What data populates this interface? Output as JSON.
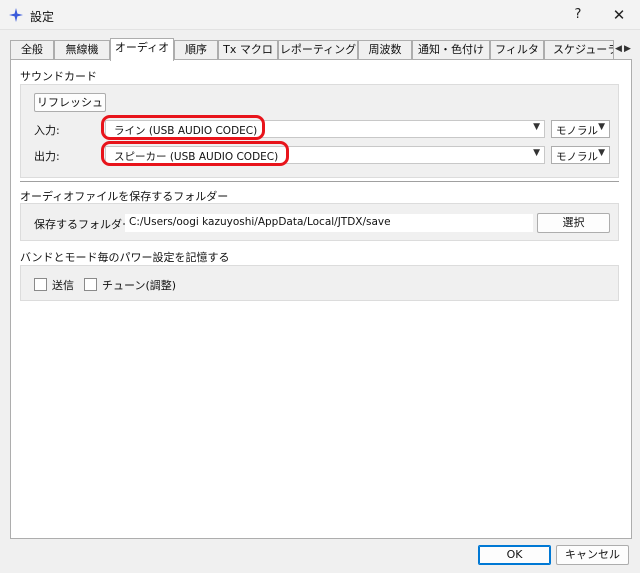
{
  "window": {
    "title": "設定",
    "help_label": "?",
    "close_label": "✕"
  },
  "tabs": [
    {
      "label": "全般"
    },
    {
      "label": "無線機"
    },
    {
      "label": "オーディオ",
      "active": true
    },
    {
      "label": "順序"
    },
    {
      "label": "Tx マクロ"
    },
    {
      "label": "レポーティング"
    },
    {
      "label": "周波数"
    },
    {
      "label": "通知・色付け"
    },
    {
      "label": "フィルタ"
    },
    {
      "label": "スケジューラ"
    }
  ],
  "tab_scroll": {
    "left": "◀",
    "right": "▶"
  },
  "soundcard": {
    "section_label": "サウンドカード",
    "refresh_button": "リフレッシュ",
    "input_label": "入力:",
    "input_device": "ライン (USB AUDIO  CODEC)",
    "input_channel": "モノラル",
    "output_label": "出力:",
    "output_device": "スピーカー (USB AUDIO  CODEC)",
    "output_channel": "モノラル",
    "highlight_color": "#e8141b"
  },
  "save_folder": {
    "section_label": "オーディオファイルを保存するフォルダー",
    "label": "保存するフォルダー:",
    "path": "C:/Users/oogi kazuyoshi/AppData/Local/JTDX/save",
    "select_button": "選択"
  },
  "power_memory": {
    "section_label": "バンドとモード毎のパワー設定を記憶する",
    "transmit_label": "送信",
    "transmit_checked": false,
    "tune_label": "チューン(調整)",
    "tune_checked": false
  },
  "footer": {
    "ok_button": "OK",
    "cancel_button": "キャンセル",
    "accent_color": "#0078d4"
  }
}
